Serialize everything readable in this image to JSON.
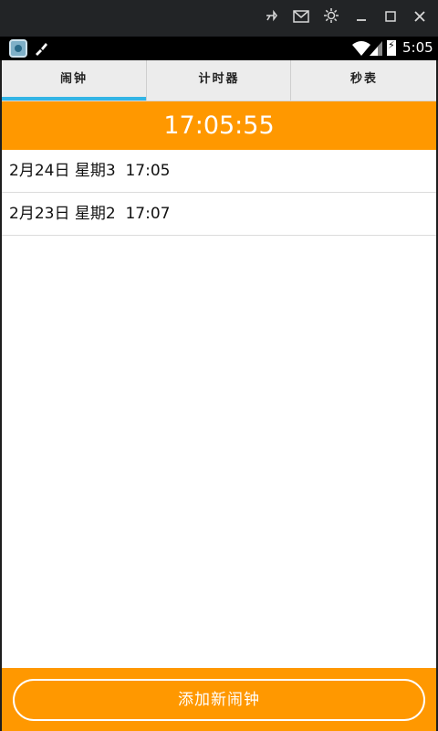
{
  "window_controls": {
    "pin_icon": "pin-icon",
    "mail_icon": "mail-icon",
    "settings_icon": "gear-icon",
    "minimize_icon": "minimize-icon",
    "maximize_icon": "maximize-icon",
    "close_icon": "close-icon"
  },
  "status_bar": {
    "time": "5:05"
  },
  "tabs": [
    {
      "label": "闹钟"
    },
    {
      "label": "计时器"
    },
    {
      "label": "秒表"
    }
  ],
  "clock": {
    "current_time": "17:05:55"
  },
  "alarms": [
    {
      "text": "2月24日 星期3  17:05"
    },
    {
      "text": "2月23日 星期2  17:07"
    }
  ],
  "actions": {
    "add_alarm_label": "添加新闹钟"
  },
  "colors": {
    "accent": "#ff9800",
    "tab_indicator": "#33b5e5"
  }
}
